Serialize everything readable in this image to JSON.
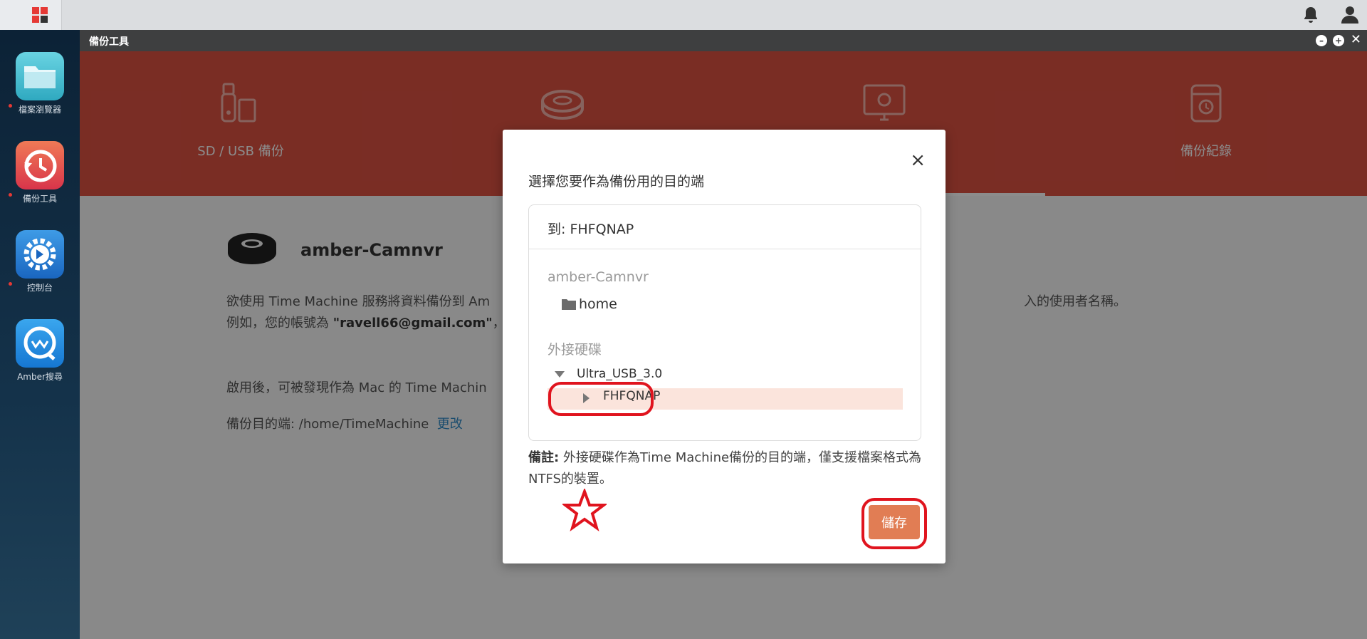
{
  "window": {
    "title": "備份工具"
  },
  "sidebar": {
    "apps": [
      {
        "label": "檔案瀏覽器",
        "icon": "folder-icon",
        "color": "#4fc3d8"
      },
      {
        "label": "備份工具",
        "icon": "backup-clock-icon",
        "color": "#e0514a"
      },
      {
        "label": "控制台",
        "icon": "gear-icon",
        "color": "#2a7fd4"
      },
      {
        "label": "Amber搜尋",
        "icon": "search-bubble-icon",
        "color": "#1e8de0"
      }
    ]
  },
  "tabs": [
    {
      "label": "SD / USB 備份",
      "icon": "usb-sd-icon"
    },
    {
      "label": "",
      "icon": "nas-device-icon"
    },
    {
      "label": "",
      "icon": "time-machine-icon"
    },
    {
      "label": "備份紀錄",
      "icon": "backup-history-icon"
    }
  ],
  "content": {
    "device_name": "amber-Camnvr",
    "line1": "欲使用 Time Machine 服務將資料備份到 Am",
    "line1_end": "入的使用者名稱。",
    "line2_prefix": "例如，您的帳號為 ",
    "line2_bold": "\"ravell66@gmail.com\"",
    "line2_suffix": "，",
    "line3": "啟用後，可被發現作為 Mac 的 Time Machin",
    "dest_label": "備份目的端: /home/TimeMachine",
    "change_link": "更改"
  },
  "modal": {
    "title": "選擇您要作為備份用的目的端",
    "close": "×",
    "target": "到: FHFQNAP",
    "device_section": "amber-Camnvr",
    "home_folder": "home",
    "external_section": "外接硬碟",
    "usb_name": "Ultra_USB_3.0",
    "selected_folder": "FHFQNAP",
    "note_label": "備註:",
    "note_text": " 外接硬碟作為Time Machine備份的目的端，僅支援檔案格式為NTFS的裝置。",
    "save_label": "儲存"
  },
  "colors": {
    "accent": "#de5243",
    "save": "#e17d54",
    "highlight": "#e0141e",
    "link": "#2e8bc9"
  }
}
